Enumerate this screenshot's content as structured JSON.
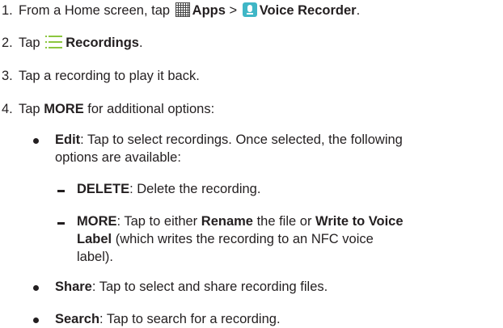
{
  "steps": [
    {
      "num": "1.",
      "prefix": "From a Home screen, tap",
      "apps_icon": "apps-grid-icon",
      "apps_label": "Apps",
      "separator": ">",
      "recorder_icon": "voice-recorder-icon",
      "recorder_label": "Voice Recorder",
      "suffix": "."
    },
    {
      "num": "2.",
      "prefix": "Tap",
      "list_icon": "list-icon",
      "label": "Recordings",
      "suffix": "."
    },
    {
      "num": "3.",
      "text": "Tap a recording to play it back."
    },
    {
      "num": "4.",
      "prefix": "Tap",
      "bold": "MORE",
      "suffix": "for additional options:"
    }
  ],
  "options": [
    {
      "title": "Edit",
      "line1": ": Tap to select recordings. Once selected, the following",
      "line2": "options are available:",
      "sub": [
        {
          "title": "DELETE",
          "text": ": Delete the recording."
        },
        {
          "title": "MORE",
          "pre": ": Tap to either",
          "rename": "Rename",
          "mid": "the file or",
          "write1": "Write to Voice",
          "write2": "Label",
          "post2": "(which writes the recording to an NFC voice",
          "line3": "label)."
        }
      ]
    },
    {
      "title": "Share",
      "text": ": Tap to select and share recording files."
    },
    {
      "title": "Search",
      "text": ": Tap to search for a recording."
    }
  ],
  "colors": {
    "text": "#231f20",
    "apps_icon": "#444444",
    "recorder_icon_bg": "#3fb6c6",
    "list_icon": "#8cc63f"
  }
}
